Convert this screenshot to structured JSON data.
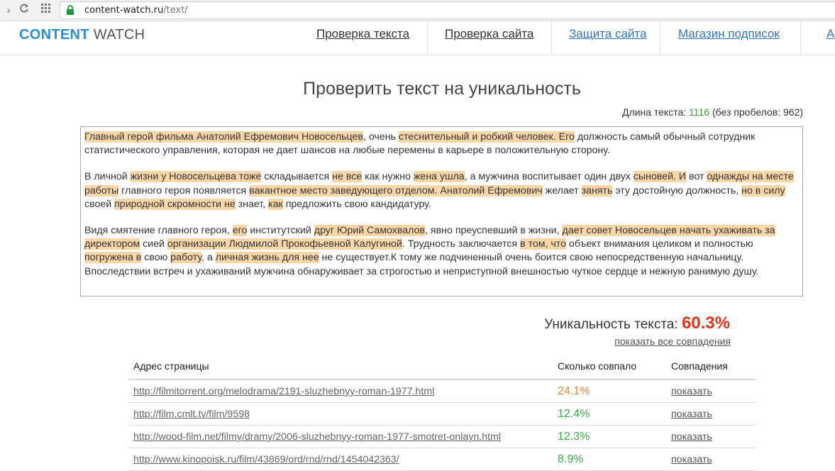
{
  "browser": {
    "url_host": "content-watch.ru",
    "url_path": "/text/"
  },
  "header": {
    "logo_part1": "CONTENT",
    "logo_part2": "WATCH",
    "nav": [
      {
        "label": "Проверка текста"
      },
      {
        "label": "Проверка сайта"
      },
      {
        "label": "Защита сайта"
      },
      {
        "label": "Магазин подписок"
      },
      {
        "label": "А"
      }
    ]
  },
  "main": {
    "title": "Проверить текст на уникальность",
    "length_label": "Длина текста:",
    "length_value": "1116",
    "length_suffix": "(без пробелов: 962)",
    "text_paragraphs": [
      [
        {
          "t": "Главный герой фильма Анатолий Ефремович Новосельцев",
          "h": true
        },
        {
          "t": ", очень ",
          "h": false
        },
        {
          "t": "стеснительный и робкий человек. Его",
          "h": true
        },
        {
          "t": " должность самый обычный сотрудник статистического управления, которая не дает шансов на любые перемены в карьере в положительную сторону.",
          "h": false
        }
      ],
      [
        {
          "t": "В личной ",
          "h": false
        },
        {
          "t": "жизни у Новосельцева тоже",
          "h": true
        },
        {
          "t": " складывается ",
          "h": false
        },
        {
          "t": "не все",
          "h": true
        },
        {
          "t": " как нужно ",
          "h": false
        },
        {
          "t": "жена ушла",
          "h": true
        },
        {
          "t": ", а мужчина воспитывает один двух ",
          "h": false
        },
        {
          "t": "сыновей. И",
          "h": true
        },
        {
          "t": " вот ",
          "h": false
        },
        {
          "t": "однажды на месте работы",
          "h": true
        },
        {
          "t": " главного героя появляется ",
          "h": false
        },
        {
          "t": "вакантное место заведующего отделом. Анатолий Ефремович",
          "h": true
        },
        {
          "t": " желает ",
          "h": false
        },
        {
          "t": "занять",
          "h": true
        },
        {
          "t": " эту достойную должность, ",
          "h": false
        },
        {
          "t": "но в силу",
          "h": true
        },
        {
          "t": " своей ",
          "h": false
        },
        {
          "t": "природной скромности не",
          "h": true
        },
        {
          "t": " знает, ",
          "h": false
        },
        {
          "t": "как",
          "h": true
        },
        {
          "t": " предложить свою кандидатуру.",
          "h": false
        }
      ],
      [
        {
          "t": "Видя смятение главного героя, ",
          "h": false
        },
        {
          "t": "его",
          "h": true
        },
        {
          "t": " институтский ",
          "h": false
        },
        {
          "t": "друг Юрий Самохвалов",
          "h": true
        },
        {
          "t": ", явно преуспевший в жизни, ",
          "h": false
        },
        {
          "t": "дает совет Новосельцев начать ухаживать за директором",
          "h": true
        },
        {
          "t": " сией ",
          "h": false
        },
        {
          "t": "организации Людмилой Прокофьевной Калугиной",
          "h": true
        },
        {
          "t": ". Трудность заключается ",
          "h": false
        },
        {
          "t": "в том, что",
          "h": true
        },
        {
          "t": " объект внимания целиком и полностью ",
          "h": false
        },
        {
          "t": "погружена в",
          "h": true
        },
        {
          "t": " свою ",
          "h": false
        },
        {
          "t": "работу",
          "h": true
        },
        {
          "t": ", а ",
          "h": false
        },
        {
          "t": "личная жизнь для нее",
          "h": true
        },
        {
          "t": " не существует.К тому же подчиненный очень боится свою непосредственную начальницу. Впоследствии встреч и ухаживаний мужчина обнаруживает за строгостью и неприступной внешностью чуткое сердце и нежную ранимую душу.",
          "h": false
        }
      ]
    ],
    "highlight_color": "#fbd7a8",
    "uniqueness_label": "Уникальность текста:",
    "uniqueness_value": "60.3%",
    "show_all_link": "показать все совпадения"
  },
  "results": {
    "headers": {
      "address": "Адрес страницы",
      "matched": "Сколько совпало",
      "matches": "Совпадения"
    },
    "rows": [
      {
        "url": "http://filmitorrent.org/melodrama/2191-sluzhebnyy-roman-1977.html",
        "percent": "24.1%",
        "color": "#e8883a",
        "action": "показать"
      },
      {
        "url": "http://film.cmlt.tv/film/9598",
        "percent": "12.4%",
        "color": "#3ea84a",
        "action": "показать"
      },
      {
        "url": "http://wood-film.net/filmy/dramy/2006-sluzhebnyy-roman-1977-smotret-onlayn.html",
        "percent": "12.3%",
        "color": "#3ea84a",
        "action": "показать"
      },
      {
        "url": "http://www.kinopoisk.ru/film/43869/ord/rnd/rnd/1454042363/",
        "percent": "8.9%",
        "color": "#3ea84a",
        "action": "показать"
      }
    ]
  }
}
